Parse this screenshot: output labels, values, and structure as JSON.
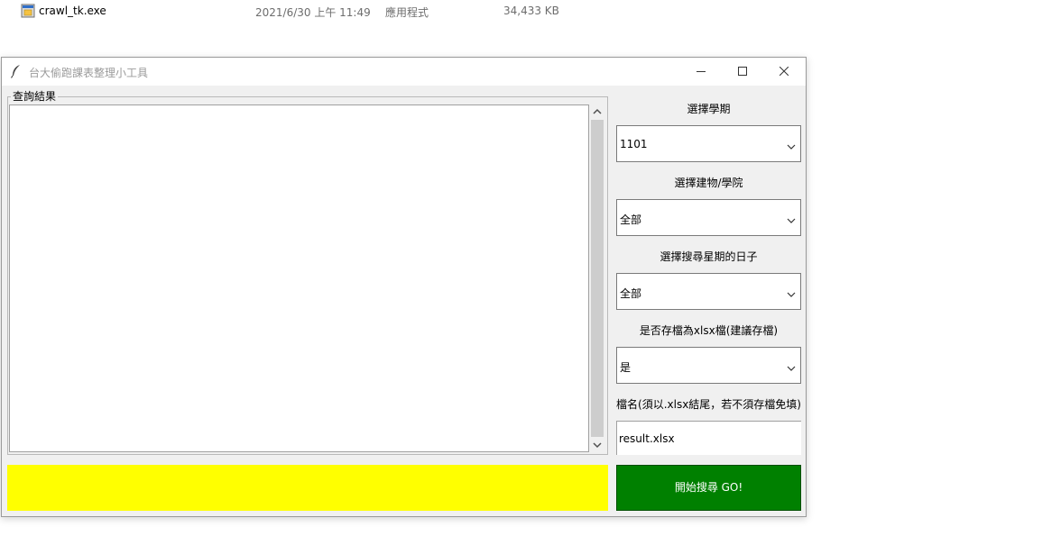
{
  "file_row": {
    "icon": "exe-file-icon",
    "name": "crawl_tk.exe",
    "date": "2021/6/30 上午 11:49",
    "type": "應用程式",
    "size": "34,433 KB"
  },
  "window": {
    "title": "台大偷跑課表整理小工具",
    "icon": "feather-icon"
  },
  "result_frame": {
    "label": "查詢結果",
    "content": ""
  },
  "status": {
    "text": "",
    "color": "#ffff00"
  },
  "semester": {
    "label": "選擇學期",
    "value": "1101"
  },
  "building": {
    "label": "選擇建物/學院",
    "value": "全部"
  },
  "weekday": {
    "label": "選擇搜尋星期的日子",
    "value": "全部"
  },
  "save_xlsx": {
    "label": "是否存檔為xlsx檔(建議存檔)",
    "value": "是"
  },
  "filename": {
    "label": "檔名(須以.xlsx結尾，若不須存檔免填)",
    "value": "result.xlsx"
  },
  "go_button": {
    "label": "開始搜尋 GO!",
    "color": "#008000"
  }
}
